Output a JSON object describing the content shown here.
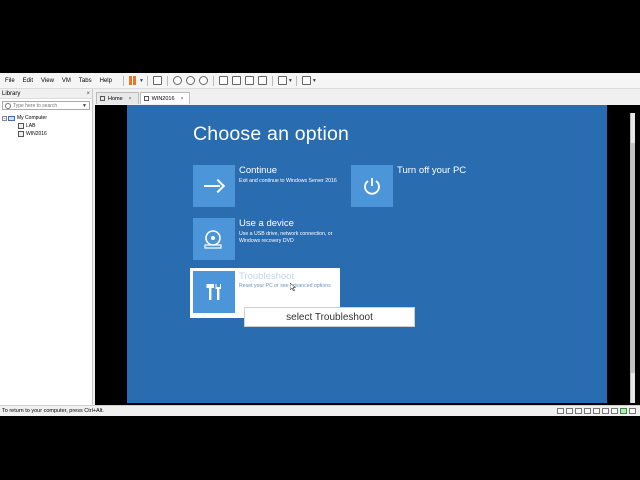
{
  "menu": [
    "File",
    "Edit",
    "View",
    "VM",
    "Tabs",
    "Help"
  ],
  "library": {
    "title": "Library",
    "close": "×",
    "search_placeholder": "Type here to search",
    "tree": {
      "root": "My Computer",
      "children": [
        "LAB",
        "WIN2016"
      ]
    }
  },
  "tabs": [
    {
      "label": "Home",
      "close": "×"
    },
    {
      "label": "WIN2016",
      "close": "×"
    }
  ],
  "vm": {
    "title": "Choose an option",
    "options": {
      "continue": {
        "title": "Continue",
        "desc": "Exit and continue to Windows Server 2016"
      },
      "turnoff": {
        "title": "Turn off your PC"
      },
      "device": {
        "title": "Use a device",
        "desc": "Use a USB drive, network connection, or Windows recovery DVD"
      },
      "troubleshoot": {
        "title": "Troubleshoot",
        "desc": "Reset your PC or see advanced options"
      }
    },
    "tile_color": "#4b95d8",
    "background_color": "#2a6cb0"
  },
  "caption": "select Troubleshoot",
  "status": "To return to your computer, press Ctrl+Alt."
}
